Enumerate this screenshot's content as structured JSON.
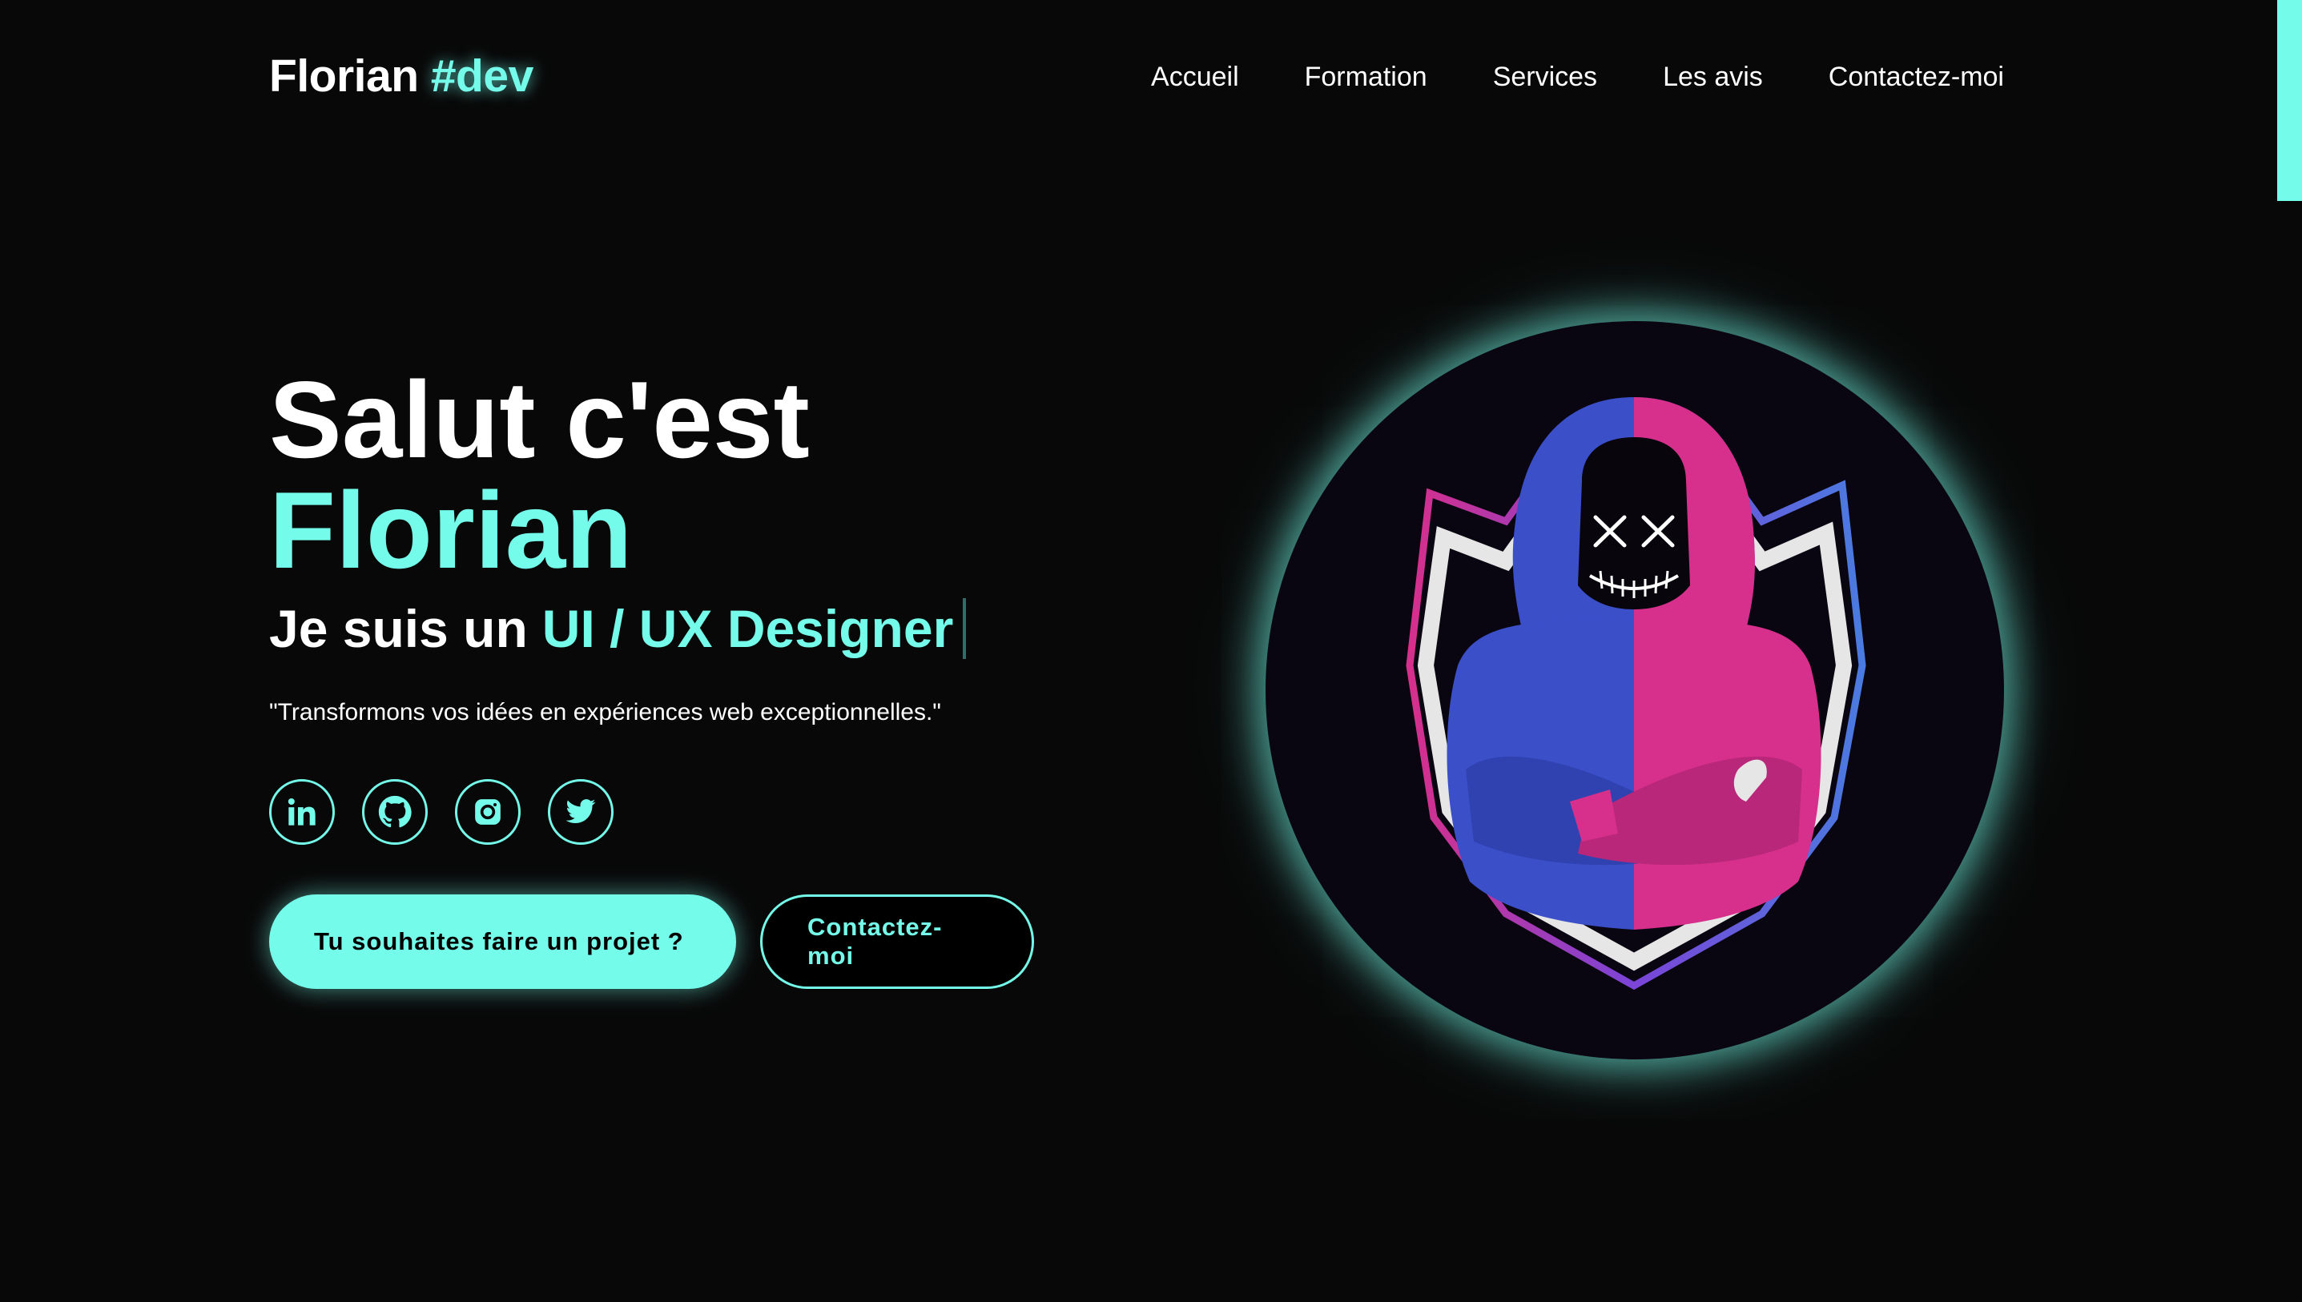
{
  "header": {
    "logo_name": "Florian",
    "logo_tag": "#dev",
    "nav": [
      {
        "label": "Accueil"
      },
      {
        "label": "Formation"
      },
      {
        "label": "Services"
      },
      {
        "label": "Les avis"
      },
      {
        "label": "Contactez-moi"
      }
    ]
  },
  "hero": {
    "greeting": "Salut c'est",
    "name": "Florian",
    "role_prefix": "Je suis un",
    "role": "UI / UX Designer",
    "tagline": "\"Transformons vos idées en expériences web exceptionnelles.\"",
    "socials": [
      {
        "icon": "linkedin-icon"
      },
      {
        "icon": "github-icon"
      },
      {
        "icon": "instagram-icon"
      },
      {
        "icon": "twitter-icon"
      }
    ],
    "primary_button": "Tu souhaites faire un projet ?",
    "secondary_button": "Contactez-moi"
  },
  "avatar": {
    "icon": "hooded-figure-mascot"
  },
  "colors": {
    "background": "#080808",
    "accent": "#74fbea",
    "text": "#ffffff",
    "hoodie_blue": "#3b4fc9",
    "hoodie_pink": "#d62f8c"
  }
}
